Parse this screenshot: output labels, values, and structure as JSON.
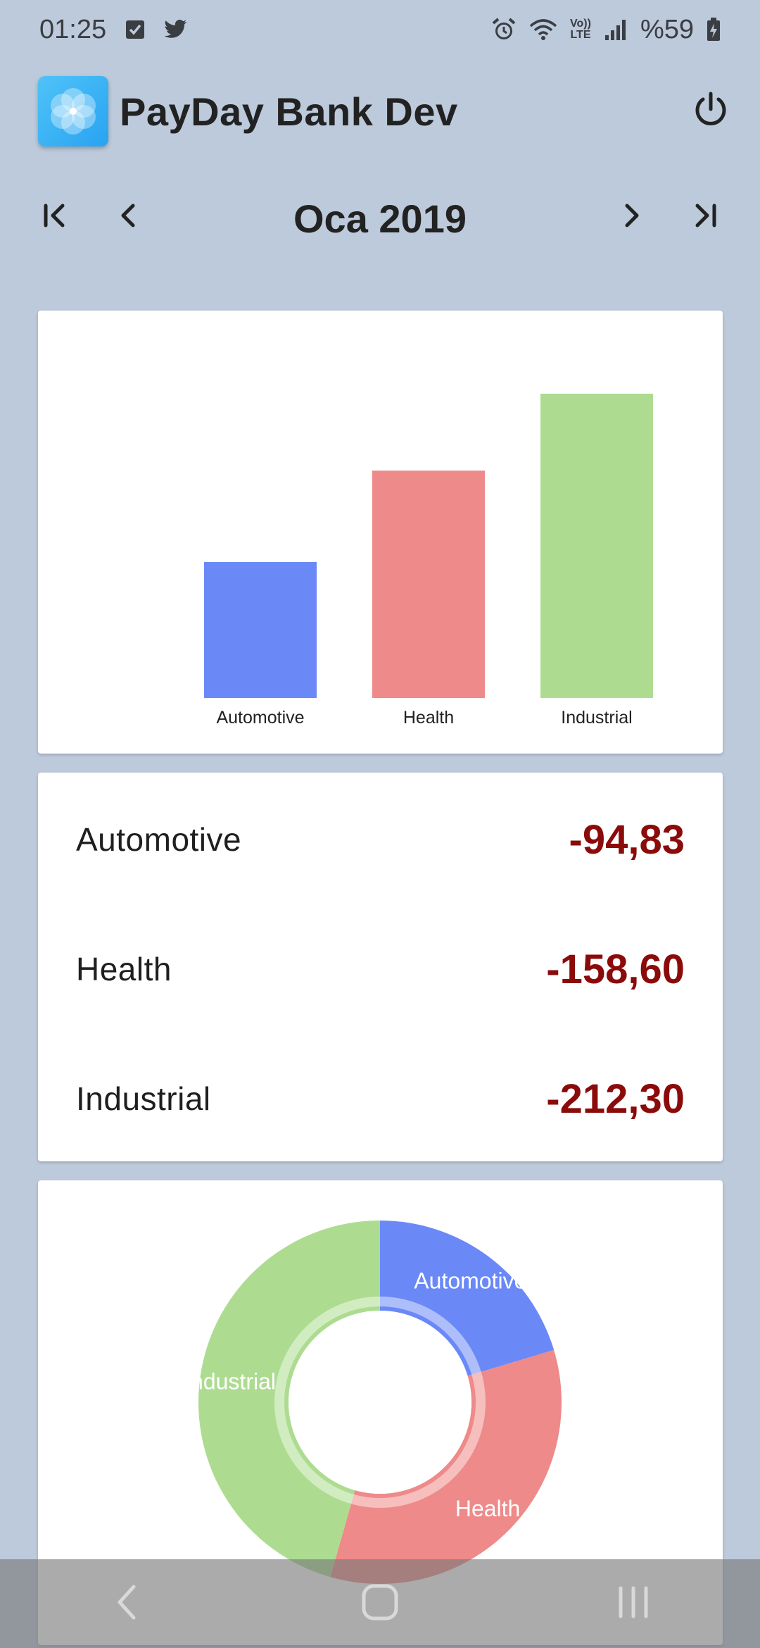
{
  "status_bar": {
    "time": "01:25",
    "left_icons": [
      "checkbox-notification-icon",
      "twitter-icon"
    ],
    "right_icons": [
      "alarm-icon",
      "wifi-icon",
      "volte-icon",
      "signal-icon",
      "battery-charging-icon"
    ],
    "volte_top": "Vo))",
    "volte_bottom": "LTE",
    "battery_percent": "%59"
  },
  "app_bar": {
    "title": "PayDay Bank Dev",
    "logo_icon": "flower-logo-icon",
    "power_icon": "power-icon"
  },
  "month_nav": {
    "label": "Oca 2019",
    "first_icon": "first-page-icon",
    "prev_icon": "chevron-left-icon",
    "next_icon": "chevron-right-icon",
    "last_icon": "last-page-icon"
  },
  "categories": [
    {
      "name": "Automotive",
      "amount_text": "-94,83"
    },
    {
      "name": "Health",
      "amount_text": "-158,60"
    },
    {
      "name": "Industrial",
      "amount_text": "-212,30"
    }
  ],
  "chart_data": [
    {
      "type": "bar",
      "categories": [
        "Automotive",
        "Health",
        "Industrial"
      ],
      "values": [
        94.83,
        158.6,
        212.3
      ],
      "colors": [
        "#6a89f7",
        "#ee8a89",
        "#addc91"
      ],
      "title": "",
      "xlabel": "",
      "ylabel": "",
      "grid": false
    },
    {
      "type": "pie",
      "variant": "donut",
      "labels": [
        "Automotive",
        "Health",
        "Industrial"
      ],
      "values": [
        94.83,
        158.6,
        212.3
      ],
      "colors": [
        "#6a89f7",
        "#ee8a89",
        "#addc91"
      ],
      "title": ""
    }
  ],
  "colors": {
    "background": "#bccadb",
    "card": "#ffffff",
    "negative_amount": "#8b0b0b"
  },
  "bottom_nav": {
    "back_icon": "back-chevron-icon",
    "home_icon": "home-icon",
    "recents_icon": "recents-icon"
  }
}
